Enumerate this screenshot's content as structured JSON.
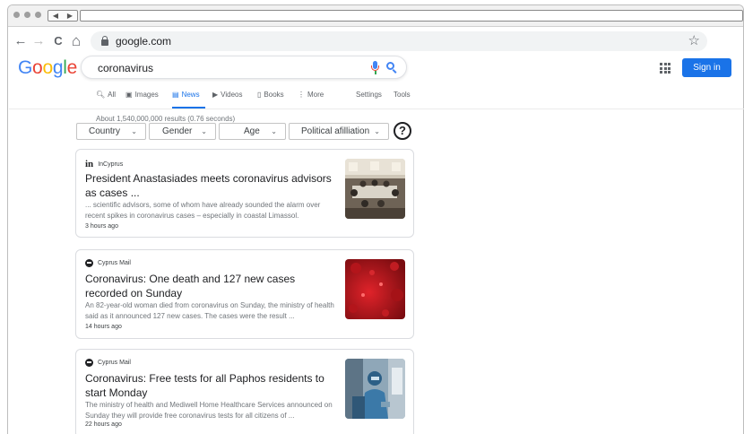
{
  "browser": {
    "url": "google.com",
    "nav_left_glyph": "◀",
    "nav_right_glyph": "▶"
  },
  "toolbar": {
    "back_glyph": "←",
    "forward_glyph": "→",
    "reload_glyph": "C",
    "home_glyph": "⌂",
    "star_glyph": "☆"
  },
  "google": {
    "logo_letters": [
      {
        "ch": "G",
        "color": "#4285f4"
      },
      {
        "ch": "o",
        "color": "#ea4335"
      },
      {
        "ch": "o",
        "color": "#fbbc05"
      },
      {
        "ch": "g",
        "color": "#4285f4"
      },
      {
        "ch": "l",
        "color": "#34a853"
      },
      {
        "ch": "e",
        "color": "#ea4335"
      }
    ],
    "query": "coronavirus",
    "signin_label": "Sign in",
    "accent_color": "#1a73e8"
  },
  "tabs": {
    "all": "All",
    "images": "Images",
    "news": "News",
    "videos": "Videos",
    "books": "Books",
    "more": "More",
    "settings": "Settings",
    "tools": "Tools",
    "active": "News"
  },
  "results_stats": "About 1,540,000,000 results (0.76 seconds)",
  "filters": {
    "country": "Country",
    "gender": "Gender",
    "age": "Age",
    "political": "Political afilliation",
    "help": "?"
  },
  "articles": [
    {
      "source": "InCyprus",
      "source_logo": "in",
      "headline": "President Anastasiades meets coronavirus advisors as cases ...",
      "snippet": "... scientific advisors, some of whom have already sounded the alarm over recent spikes in coronavirus cases – especially in coastal Limassol.",
      "time": "3 hours ago",
      "thumbnail": "meeting-room-photo"
    },
    {
      "source": "Cyprus Mail",
      "source_logo": "cyprus-mail-logo",
      "headline": "Coronavirus: One death and 127 new cases recorded on Sunday",
      "snippet": "An 82-year-old woman died from coronavirus on Sunday, the ministry of health said as it announced 127 new cases. The cases were the result ...",
      "time": "14 hours ago",
      "thumbnail": "virus-illustration"
    },
    {
      "source": "Cyprus Mail",
      "source_logo": "cyprus-mail-logo",
      "headline": "Coronavirus: Free tests for all Paphos residents to start Monday",
      "snippet": "The ministry of health and Mediwell Home Healthcare Services announced on Sunday they will provide free coronavirus tests for all citizens of ...",
      "time": "22 hours ago",
      "thumbnail": "lab-worker-photo"
    }
  ]
}
